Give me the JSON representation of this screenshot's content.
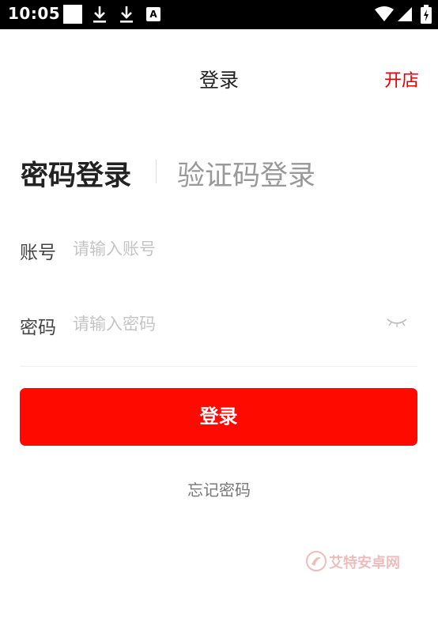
{
  "status_bar": {
    "time": "10:05",
    "icons": [
      "square-notification-icon",
      "download-icon",
      "download-icon",
      "a-font-icon",
      "wifi-icon",
      "signal-icon",
      "battery-icon"
    ]
  },
  "header": {
    "title": "登录",
    "action": "开店"
  },
  "tabs": {
    "active": "密码登录",
    "inactive": "验证码登录"
  },
  "form": {
    "account_label": "账号",
    "account_placeholder": "请输入账号",
    "password_label": "密码",
    "password_placeholder": "请输入密码"
  },
  "login_button": "登录",
  "forgot_password": "忘记密码",
  "watermark": {
    "text": "艾特安卓网"
  },
  "colors": {
    "accent": "#ff0a00",
    "action_text": "#e60000"
  }
}
